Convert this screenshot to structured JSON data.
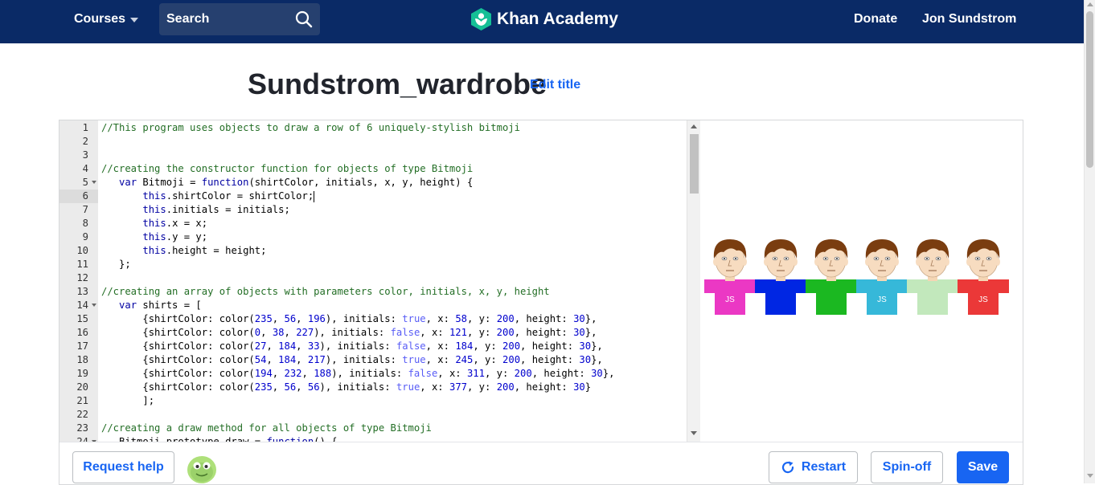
{
  "nav": {
    "courses_label": "Courses",
    "search_label": "Search",
    "brand_name": "Khan Academy",
    "donate_label": "Donate",
    "user_name": "Jon Sundstrom",
    "background_color": "#0a2a66",
    "brand_color": "#14bf96"
  },
  "page": {
    "title": "Sundstrom_wardrobe",
    "edit_title_label": "Edit title"
  },
  "editor": {
    "lines": [
      {
        "n": "1",
        "code": "//This program uses objects to draw a row of 6 uniquely-stylish bitmoji"
      },
      {
        "n": "2",
        "code": ""
      },
      {
        "n": "3",
        "code": ""
      },
      {
        "n": "4",
        "code": "//creating the constructor function for objects of type Bitmoji"
      },
      {
        "n": "5",
        "code": "   var Bitmoji = function(shirtColor, initials, x, y, height) {",
        "fold": true
      },
      {
        "n": "6",
        "code": "       this.shirtColor = shirtColor;",
        "active": true
      },
      {
        "n": "7",
        "code": "       this.initials = initials;"
      },
      {
        "n": "8",
        "code": "       this.x = x;"
      },
      {
        "n": "9",
        "code": "       this.y = y;"
      },
      {
        "n": "10",
        "code": "       this.height = height;"
      },
      {
        "n": "11",
        "code": "   };"
      },
      {
        "n": "12",
        "code": ""
      },
      {
        "n": "13",
        "code": "//creating an array of objects with parameters color, initials, x, y, height"
      },
      {
        "n": "14",
        "code": "   var shirts = [",
        "fold": true
      },
      {
        "n": "15",
        "code": "       {shirtColor: color(235, 56, 196), initials: true, x: 58, y: 200, height: 30},"
      },
      {
        "n": "16",
        "code": "       {shirtColor: color(0, 38, 227), initials: false, x: 121, y: 200, height: 30},"
      },
      {
        "n": "17",
        "code": "       {shirtColor: color(27, 184, 33), initials: false, x: 184, y: 200, height: 30},"
      },
      {
        "n": "18",
        "code": "       {shirtColor: color(54, 184, 217), initials: true, x: 245, y: 200, height: 30},"
      },
      {
        "n": "19",
        "code": "       {shirtColor: color(194, 232, 188), initials: false, x: 311, y: 200, height: 30},"
      },
      {
        "n": "20",
        "code": "       {shirtColor: color(235, 56, 56), initials: true, x: 377, y: 200, height: 30}"
      },
      {
        "n": "21",
        "code": "       ];"
      },
      {
        "n": "22",
        "code": ""
      },
      {
        "n": "23",
        "code": "//creating a draw method for all objects of type Bitmoji"
      },
      {
        "n": "24",
        "code": "   Bitmoji.prototype.draw = function() {",
        "fold": true
      }
    ]
  },
  "canvas": {
    "bitmoji": [
      {
        "shirt": "#eb38c4",
        "initials": "JS",
        "show_initials": true
      },
      {
        "shirt": "#0026e3",
        "initials": "",
        "show_initials": false
      },
      {
        "shirt": "#1bb821",
        "initials": "",
        "show_initials": false
      },
      {
        "shirt": "#36b8d9",
        "initials": "JS",
        "show_initials": true
      },
      {
        "shirt": "#c2e8bc",
        "initials": "",
        "show_initials": false
      },
      {
        "shirt": "#eb3838",
        "initials": "JS",
        "show_initials": true
      }
    ]
  },
  "toolbar": {
    "request_help_label": "Request help",
    "restart_label": "Restart",
    "spinoff_label": "Spin-off",
    "save_label": "Save",
    "accent_color": "#1865f2"
  }
}
